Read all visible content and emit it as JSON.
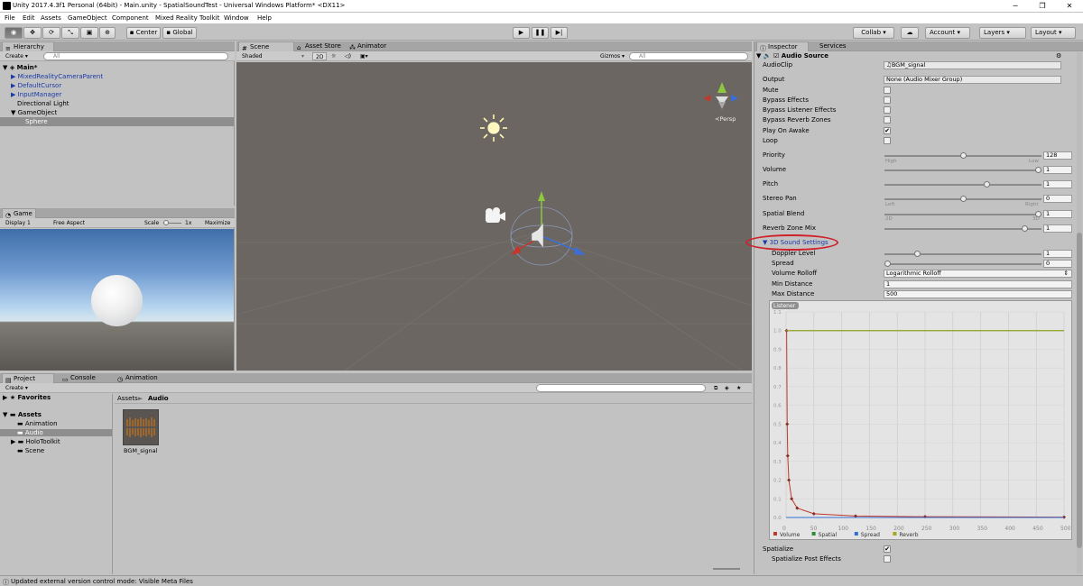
{
  "window": {
    "title": "Unity 2017.4.3f1 Personal (64bit) - Main.unity - SpatialSoundTest - Universal Windows Platform* <DX11>",
    "minimize": "─",
    "maximize": "❐",
    "close": "✕"
  },
  "menu": [
    "File",
    "Edit",
    "Assets",
    "GameObject",
    "Component",
    "Mixed Reality Toolkit",
    "Window",
    "Help"
  ],
  "toolbar": {
    "pivot": "Center",
    "space": "Global",
    "collab": "Collab ▾",
    "account": "Account",
    "layers": "Layers",
    "layout": "Layout"
  },
  "hierarchy": {
    "tab": "Hierarchy",
    "create": "Create ▾",
    "search_placeholder": "All",
    "scene": "Main*",
    "items": [
      "MixedRealityCameraParent",
      "DefaultCursor",
      "InputManager",
      "Directional Light",
      "GameObject",
      "Sphere"
    ]
  },
  "scene": {
    "tabs": [
      "Scene",
      "Asset Store",
      "Animator"
    ],
    "shading": "Shaded",
    "mode2d": "2D",
    "gizmos": "Gizmos ▾",
    "search_placeholder": "All",
    "persp": "≺Persp"
  },
  "game": {
    "tab": "Game",
    "display": "Display 1",
    "aspect": "Free Aspect",
    "scale_label": "Scale",
    "scale_value": "1x",
    "maximize": "Maximize"
  },
  "project": {
    "tabs": [
      "Project",
      "Console",
      "Animation"
    ],
    "create": "Create ▾",
    "favorites": "Favorites",
    "assets": "Assets",
    "folders": [
      "Animation",
      "Audio",
      "HoloToolkit",
      "Scene"
    ],
    "breadcrumb_root": "Assets",
    "breadcrumb_sep": "►",
    "breadcrumb_current": "Audio",
    "asset_name": "BGM_signal"
  },
  "inspector": {
    "tabs": [
      "Inspector",
      "Services"
    ],
    "component": "Audio Source",
    "audioclip_label": "AudioClip",
    "audioclip_value": "BGM_signal",
    "output_label": "Output",
    "output_value": "None (Audio Mixer Group)",
    "toggles": [
      {
        "label": "Mute",
        "checked": ""
      },
      {
        "label": "Bypass Effects",
        "checked": ""
      },
      {
        "label": "Bypass Listener Effects",
        "checked": ""
      },
      {
        "label": "Bypass Reverb Zones",
        "checked": ""
      },
      {
        "label": "Play On Awake",
        "checked": "✔"
      },
      {
        "label": "Loop",
        "checked": ""
      }
    ],
    "priority": {
      "label": "Priority",
      "value": "128",
      "fraction": 0.5,
      "min_label": "High",
      "max_label": "Low"
    },
    "volume": {
      "label": "Volume",
      "value": "1",
      "fraction": 1
    },
    "pitch": {
      "label": "Pitch",
      "value": "1",
      "fraction": 0.66
    },
    "stereo_pan": {
      "label": "Stereo Pan",
      "value": "0",
      "fraction": 0.5,
      "min_label": "Left",
      "max_label": "Right"
    },
    "spatial_blend": {
      "label": "Spatial Blend",
      "value": "1",
      "fraction": 1,
      "min_label": "2D",
      "max_label": "3D"
    },
    "reverb_zone_mix": {
      "label": "Reverb Zone Mix",
      "value": "1",
      "fraction": 0.91
    },
    "sound3d": {
      "label": "3D Sound Settings"
    },
    "doppler": {
      "label": "Doppler Level",
      "value": "1",
      "fraction": 0.2
    },
    "spread": {
      "label": "Spread",
      "value": "0",
      "fraction": 0
    },
    "rolloff": {
      "label": "Volume Rolloff",
      "value": "Logarithmic Rolloff"
    },
    "min_distance": {
      "label": "Min Distance",
      "value": "1"
    },
    "max_distance": {
      "label": "Max Distance",
      "value": "500"
    },
    "spatialize": {
      "label": "Spatialize",
      "checked": "✔"
    },
    "spatialize_post": {
      "label": "Spatialize Post Effects",
      "checked": ""
    }
  },
  "chart_data": {
    "type": "line",
    "listener_label": "Listener",
    "xlim": [
      0,
      500
    ],
    "ylim": [
      0,
      1.1
    ],
    "x_ticks": [
      "0",
      "50",
      "100",
      "150",
      "200",
      "250",
      "300",
      "350",
      "400",
      "450",
      "500"
    ],
    "y_ticks": [
      "0.0",
      "0.1",
      "0.2",
      "0.3",
      "0.4",
      "0.5",
      "0.6",
      "0.7",
      "0.8",
      "0.9",
      "1.0",
      "1.1"
    ],
    "series": [
      {
        "name": "Volume",
        "color": "#c0392b",
        "x": [
          1,
          2,
          3,
          5,
          10,
          20,
          50,
          125,
          250,
          500
        ],
        "y": [
          1,
          0.5,
          0.33,
          0.2,
          0.1,
          0.05,
          0.02,
          0.008,
          0.004,
          0.002
        ]
      },
      {
        "name": "Spatial",
        "color": "#2e8b2e",
        "x": [
          0,
          500
        ],
        "y": [
          1,
          1
        ]
      },
      {
        "name": "Spread",
        "color": "#2f6fd6",
        "x": [
          0,
          500
        ],
        "y": [
          0,
          0
        ]
      },
      {
        "name": "Reverb",
        "color": "#a5a51e",
        "x": [
          0,
          500
        ],
        "y": [
          1,
          1
        ]
      }
    ],
    "legend_position": "bottom-left"
  },
  "statusbar": "Updated external version control mode: Visible Meta Files"
}
